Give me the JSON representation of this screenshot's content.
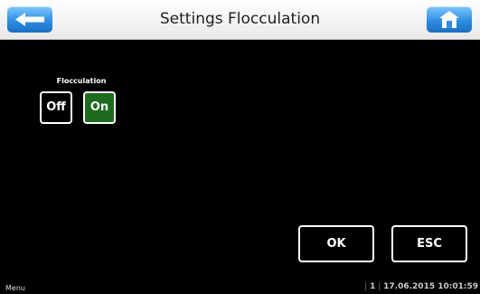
{
  "header": {
    "title": "Settings Flocculation",
    "back_icon": "back-arrow-icon",
    "home_icon": "home-icon"
  },
  "flocculation": {
    "label": "Flocculation",
    "off_label": "Off",
    "on_label": "On",
    "selected": "On",
    "active_color": "#1e6b1e"
  },
  "actions": {
    "ok_label": "OK",
    "esc_label": "ESC"
  },
  "footer": {
    "menu_label": "Menu",
    "page_number": "1",
    "datetime": "17.06.2015 10:01:59"
  }
}
